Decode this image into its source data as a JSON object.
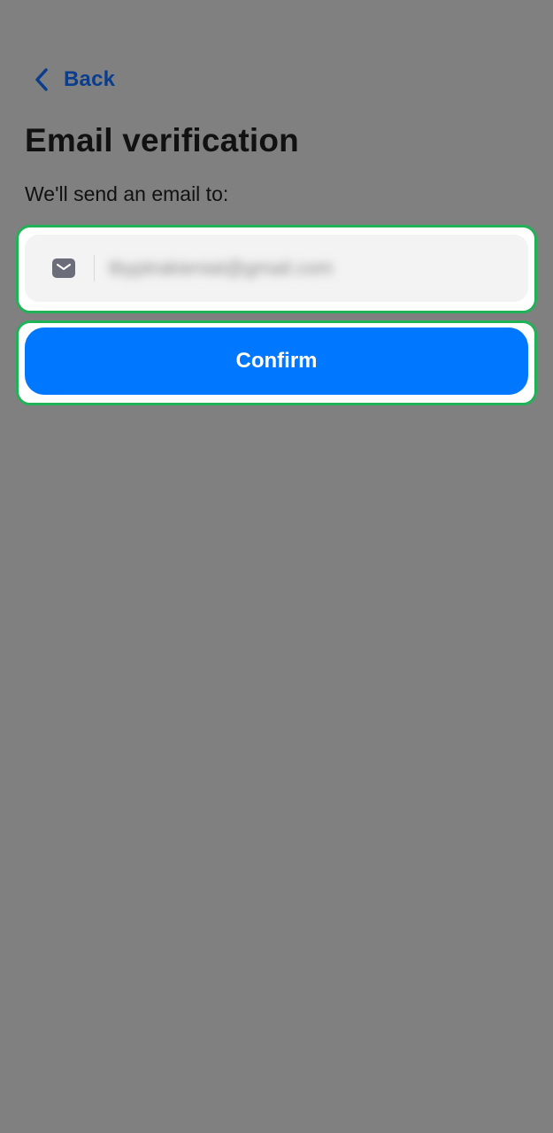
{
  "header": {
    "back_label": "Back"
  },
  "content": {
    "title": "Email verification",
    "subtitle": "We'll send an email to:",
    "email_value": "tbyptrakieniat@gmail.com"
  },
  "actions": {
    "confirm_label": "Confirm"
  },
  "icons": {
    "back": "chevron-left-icon",
    "email": "envelope-icon"
  },
  "colors": {
    "background_overlay": "#808080",
    "back_text": "#0a3d8c",
    "primary_button": "#0077ff",
    "highlight_border": "#1fb257",
    "field_background": "#f3f3f4"
  }
}
